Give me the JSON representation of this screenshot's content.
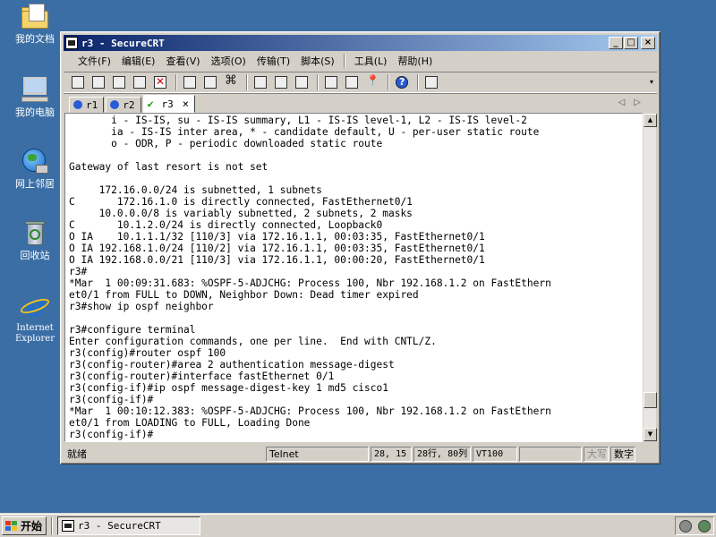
{
  "desktop": {
    "icons": [
      {
        "label": "我的文档"
      },
      {
        "label": "我的电脑"
      },
      {
        "label": "网上邻居"
      },
      {
        "label": "回收站"
      },
      {
        "label": "Internet Explorer"
      }
    ]
  },
  "window": {
    "title": "r3 - SecureCRT",
    "controls": {
      "minimize": "_",
      "maximize": "□",
      "close": "×"
    }
  },
  "menubar": {
    "items": [
      "文件(F)",
      "编辑(E)",
      "查看(V)",
      "选项(O)",
      "传输(T)",
      "脚本(S)",
      "工具(L)",
      "帮助(H)"
    ]
  },
  "toolbar": {
    "icons": [
      "connect-icon",
      "quick-connect-icon",
      "connect-tab-icon",
      "reconnect-icon",
      "disconnect-icon",
      "copy-icon",
      "paste-icon",
      "find-icon",
      "print-icon",
      "print-selection-icon",
      "print-setup-icon",
      "session-options-icon",
      "global-options-icon",
      "keymap-icon",
      "help-icon",
      "screenshot-icon"
    ],
    "overflow": "▾"
  },
  "tabs": [
    {
      "label": "r1",
      "active": false
    },
    {
      "label": "r2",
      "active": false
    },
    {
      "label": "r3",
      "active": true,
      "close": "×"
    }
  ],
  "tab_nav": {
    "prev": "◁",
    "next": "▷"
  },
  "terminal": {
    "lines": [
      "       i - IS-IS, su - IS-IS summary, L1 - IS-IS level-1, L2 - IS-IS level-2",
      "       ia - IS-IS inter area, * - candidate default, U - per-user static route",
      "       o - ODR, P - periodic downloaded static route",
      "",
      "Gateway of last resort is not set",
      "",
      "     172.16.0.0/24 is subnetted, 1 subnets",
      "C       172.16.1.0 is directly connected, FastEthernet0/1",
      "     10.0.0.0/8 is variably subnetted, 2 subnets, 2 masks",
      "C       10.1.2.0/24 is directly connected, Loopback0",
      "O IA    10.1.1.1/32 [110/3] via 172.16.1.1, 00:03:35, FastEthernet0/1",
      "O IA 192.168.1.0/24 [110/2] via 172.16.1.1, 00:03:35, FastEthernet0/1",
      "O IA 192.168.0.0/21 [110/3] via 172.16.1.1, 00:00:20, FastEthernet0/1",
      "r3#",
      "*Mar  1 00:09:31.683: %OSPF-5-ADJCHG: Process 100, Nbr 192.168.1.2 on FastEthern",
      "et0/1 from FULL to DOWN, Neighbor Down: Dead timer expired",
      "r3#show ip ospf neighbor",
      "",
      "r3#configure terminal",
      "Enter configuration commands, one per line.  End with CNTL/Z.",
      "r3(config)#router ospf 100",
      "r3(config-router)#area 2 authentication message-digest",
      "r3(config-router)#interface fastEthernet 0/1",
      "r3(config-if)#ip ospf message-digest-key 1 md5 cisco1",
      "r3(config-if)#",
      "*Mar  1 00:10:12.383: %OSPF-5-ADJCHG: Process 100, Nbr 192.168.1.2 on FastEthern",
      "et0/1 from LOADING to FULL, Loading Done",
      "r3(config-if)#"
    ]
  },
  "scrollbar": {
    "up": "▲",
    "down": "▼",
    "position": 0.93
  },
  "statusbar": {
    "ready": "就绪",
    "protocol": "Telnet",
    "cursor": "28, 15",
    "size": "28行, 80列",
    "emulation": "VT100",
    "blank": "",
    "caps": "大写",
    "num": "数字"
  },
  "taskbar": {
    "start": "开始",
    "task_label": "r3 - SecureCRT"
  },
  "colors": {
    "desktop": "#3a6ea5",
    "titlebar_start": "#0a246a",
    "titlebar_end": "#a6caf0",
    "chrome": "#d4d0c8",
    "tab_status_ok": "#1a9a1a"
  }
}
